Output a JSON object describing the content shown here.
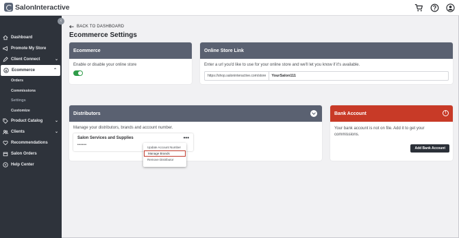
{
  "brand": {
    "name": "SalonInteractive",
    "accent": "#5a6577"
  },
  "topbar": {
    "icons": [
      "cart-icon",
      "help-icon",
      "user-icon"
    ]
  },
  "sidebar": {
    "collapse_glyph": "‹",
    "items": [
      {
        "label": "Dashboard",
        "icon": "home-icon"
      },
      {
        "label": "Promote My Store",
        "icon": "megaphone-icon"
      },
      {
        "label": "Client Connect",
        "icon": "pen-icon",
        "chevron": "⌄"
      },
      {
        "label": "Ecommerce",
        "icon": "dollar-icon",
        "chevron": "⌃"
      },
      {
        "label": "Product Catalog",
        "icon": "tag-icon",
        "chevron": "⌄"
      },
      {
        "label": "Clients",
        "icon": "people-icon",
        "chevron": "⌄"
      },
      {
        "label": "Recommendations",
        "icon": "heart-icon"
      },
      {
        "label": "Salon Orders",
        "icon": "box-icon"
      },
      {
        "label": "Help Center",
        "icon": "question-icon"
      }
    ],
    "ecommerce_sub": [
      "Orders",
      "Commissions",
      "Settings",
      "Customize"
    ],
    "selected_sub": "Settings"
  },
  "main": {
    "back_label": "BACK TO DASHBOARD",
    "title": "Ecommerce Settings"
  },
  "ecommerce_card": {
    "title": "Ecommerce",
    "text": "Enable or disable your online store",
    "enabled": true,
    "toggle_color": "#2f9c49"
  },
  "store_link_card": {
    "title": "Online Store Link",
    "text": "Enter a url you'd like to use for your online store and we'll let you know if it's available.",
    "prefix": "https://shop.saloninteractive.com/store",
    "value": "YourSalon111"
  },
  "distributors_card": {
    "title": "Distributors",
    "text": "Manage your distributors, brands and account number.",
    "distributor": {
      "name": "Salon Services and Supplies",
      "masked": "••••••",
      "more": "•••"
    },
    "menu": [
      "Update Account Number",
      "Manage Brands",
      "Remove Distributor"
    ]
  },
  "bank_card": {
    "title": "Bank Account",
    "alert_glyph": "!",
    "text": "Your bank account is not on file. Add it to get your commissions.",
    "button": "Add Bank Account",
    "header_color": "#c83a27"
  }
}
